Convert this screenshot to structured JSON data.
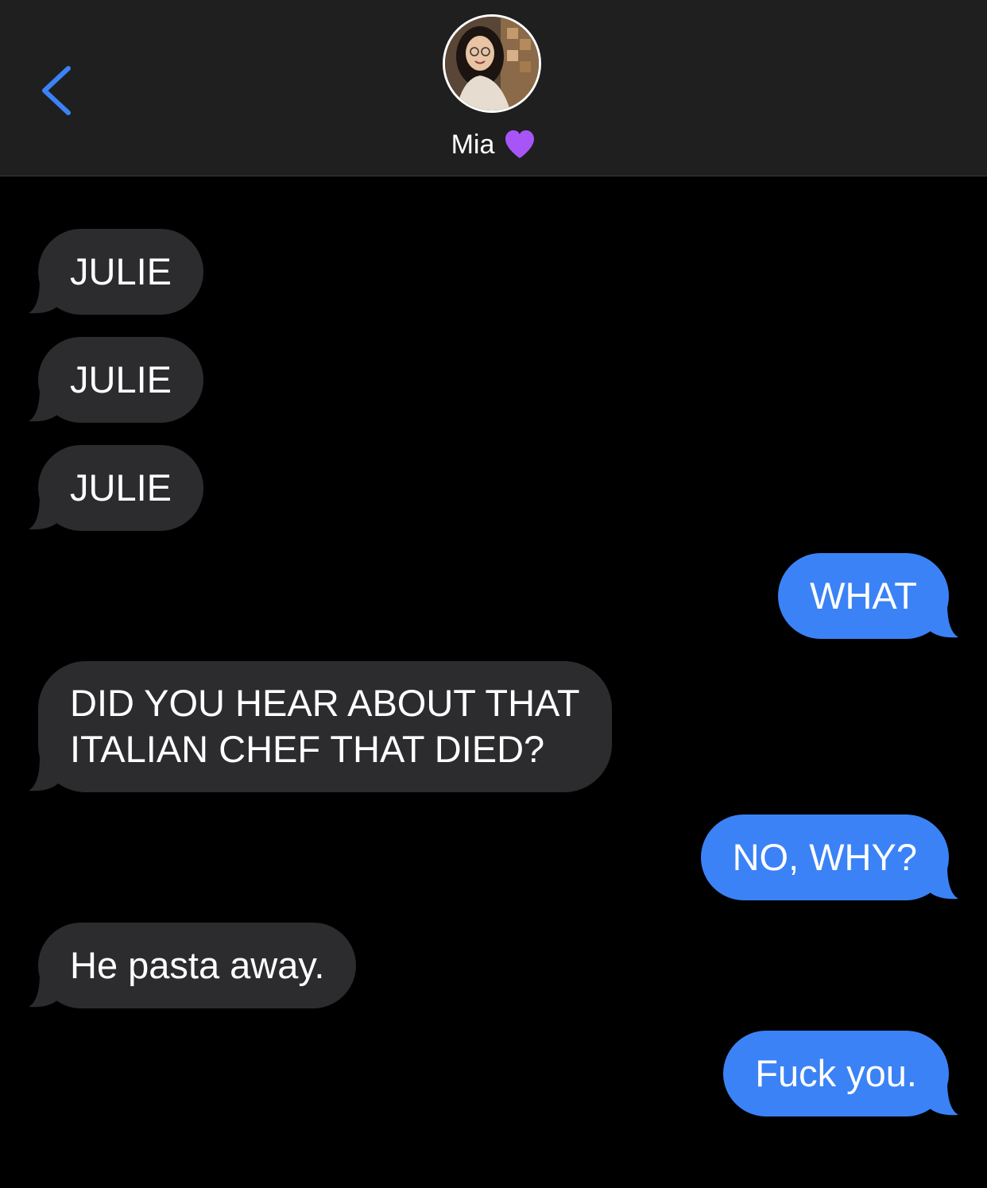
{
  "header": {
    "back_icon": "chevron-left-icon",
    "contact_name": "Mia",
    "contact_emoji": "purple-heart-icon",
    "accent_color": "#3b82f6"
  },
  "messages": [
    {
      "direction": "incoming",
      "text": "JULIE"
    },
    {
      "direction": "incoming",
      "text": "JULIE"
    },
    {
      "direction": "incoming",
      "text": "JULIE"
    },
    {
      "direction": "outgoing",
      "text": "WHAT"
    },
    {
      "direction": "incoming",
      "lines": [
        "DID YOU HEAR ABOUT THAT",
        "ITALIAN CHEF THAT DIED?"
      ]
    },
    {
      "direction": "outgoing",
      "text": "NO, WHY?"
    },
    {
      "direction": "incoming",
      "text": "He pasta away."
    },
    {
      "direction": "outgoing",
      "text": "Fuck you."
    }
  ],
  "colors": {
    "incoming_bubble": "#2c2c2e",
    "outgoing_bubble": "#3b82f6",
    "background": "#000000",
    "header_background": "#1f1f1f"
  }
}
